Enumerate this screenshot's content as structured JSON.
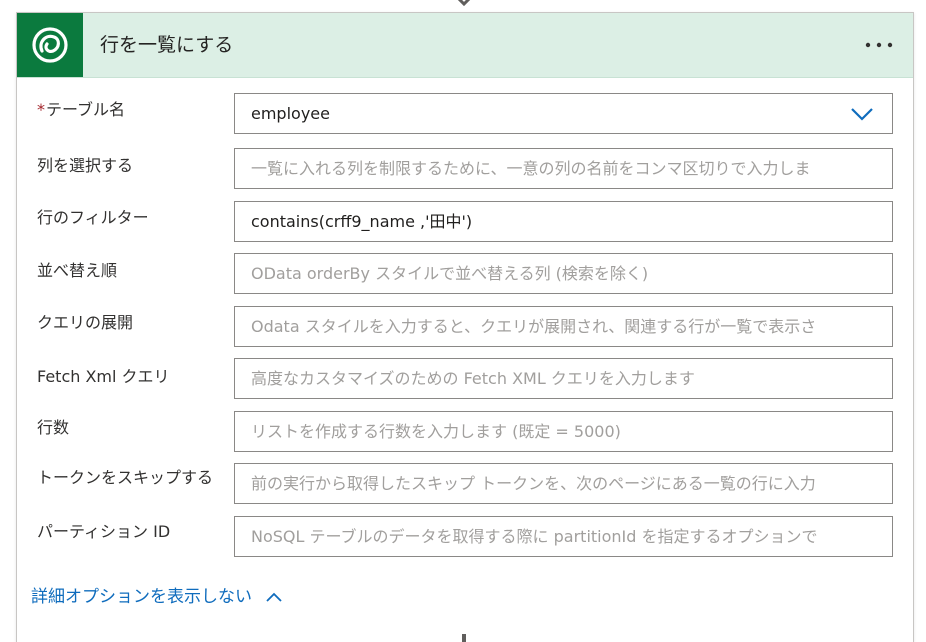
{
  "action": {
    "title": "行を一覧にする",
    "more_label": "・・・"
  },
  "fields": [
    {
      "id": "table-name",
      "label": "テーブル名",
      "required": true,
      "value": "employee",
      "placeholder": "",
      "type": "dropdown"
    },
    {
      "id": "select-columns",
      "label": "列を選択する",
      "required": false,
      "value": "",
      "placeholder": "一覧に入れる列を制限するために、一意の列の名前をコンマ区切りで入力しま",
      "type": "text"
    },
    {
      "id": "filter-rows",
      "label": "行のフィルター",
      "required": false,
      "value": "contains(crff9_name ,'田中')",
      "placeholder": "",
      "type": "text"
    },
    {
      "id": "sort-by",
      "label": "並べ替え順",
      "required": false,
      "value": "",
      "placeholder": "OData orderBy スタイルで並べ替える列 (検索を除く)",
      "type": "text"
    },
    {
      "id": "expand-query",
      "label": "クエリの展開",
      "required": false,
      "value": "",
      "placeholder": "Odata スタイルを入力すると、クエリが展開され、関連する行が一覧で表示さ",
      "type": "text"
    },
    {
      "id": "fetch-xml",
      "label": "Fetch Xml クエリ",
      "required": false,
      "value": "",
      "placeholder": "高度なカスタマイズのための Fetch XML クエリを入力します",
      "type": "text"
    },
    {
      "id": "row-count",
      "label": "行数",
      "required": false,
      "value": "",
      "placeholder": "リストを作成する行数を入力します (既定 = 5000)",
      "type": "text"
    },
    {
      "id": "skip-token",
      "label": "トークンをスキップする",
      "required": false,
      "value": "",
      "placeholder": "前の実行から取得したスキップ トークンを、次のページにある一覧の行に入力",
      "type": "text"
    },
    {
      "id": "partition-id",
      "label": "パーティション ID",
      "required": false,
      "value": "",
      "placeholder": "NoSQL テーブルのデータを取得する際に partitionId を指定するオプションで",
      "type": "text"
    }
  ],
  "advanced_toggle_label": "詳細オプションを表示しない",
  "colors": {
    "header_bg": "#dcefe5",
    "logo_bg": "#0b7a3e",
    "link": "#0f6cbd",
    "required": "#a4262c"
  },
  "icons": {
    "logo": "dataverse-logo-icon",
    "more": "more-options-icon",
    "dropdown": "chevron-down-icon",
    "collapse": "chevron-up-icon"
  }
}
